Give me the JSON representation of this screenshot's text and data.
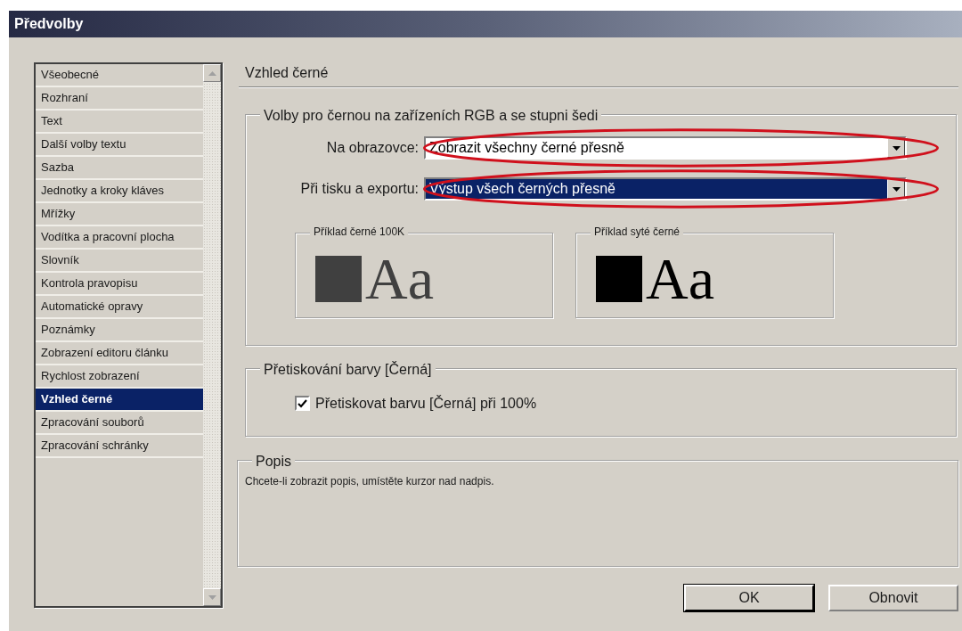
{
  "window": {
    "title": "Předvolby"
  },
  "sidebar": {
    "items": [
      {
        "label": "Všeobecné",
        "selected": false
      },
      {
        "label": "Rozhraní",
        "selected": false
      },
      {
        "label": "Text",
        "selected": false
      },
      {
        "label": "Další volby textu",
        "selected": false
      },
      {
        "label": "Sazba",
        "selected": false
      },
      {
        "label": "Jednotky a kroky kláves",
        "selected": false
      },
      {
        "label": "Mřížky",
        "selected": false
      },
      {
        "label": "Vodítka a pracovní plocha",
        "selected": false
      },
      {
        "label": "Slovník",
        "selected": false
      },
      {
        "label": "Kontrola pravopisu",
        "selected": false
      },
      {
        "label": "Automatické opravy",
        "selected": false
      },
      {
        "label": "Poznámky",
        "selected": false
      },
      {
        "label": "Zobrazení editoru článku",
        "selected": false
      },
      {
        "label": "Rychlost zobrazení",
        "selected": false
      },
      {
        "label": "Vzhled černé",
        "selected": true
      },
      {
        "label": "Zpracování souborů",
        "selected": false
      },
      {
        "label": "Zpracování schránky",
        "selected": false
      }
    ]
  },
  "panel": {
    "title": "Vzhled černé",
    "rgb_group": {
      "legend": "Volby pro černou na zařízeních RGB a se stupni šedi",
      "fields": [
        {
          "label": "Na obrazovce:",
          "value": "Zobrazit všechny černé přesně",
          "focused": false,
          "highlighted": true
        },
        {
          "label": "Při tisku a exportu:",
          "value": "Výstup všech černých přesně",
          "focused": true,
          "highlighted": true
        }
      ],
      "samples": [
        {
          "legend": "Příklad černé 100K",
          "text": "Aa",
          "color": "#404040"
        },
        {
          "legend": "Příklad syté černé",
          "text": "Aa",
          "color": "#000000"
        }
      ]
    },
    "overprint_group": {
      "legend": "Přetiskování barvy [Černá]",
      "checkbox": {
        "label": "Přetiskovat barvu [Černá] při 100%",
        "checked": true
      }
    },
    "description": {
      "legend": "Popis",
      "text": "Chcete-li zobrazit popis, umístěte kurzor nad nadpis."
    }
  },
  "buttons": [
    {
      "label": "OK",
      "default": true
    },
    {
      "label": "Obnovit",
      "default": false
    }
  ]
}
